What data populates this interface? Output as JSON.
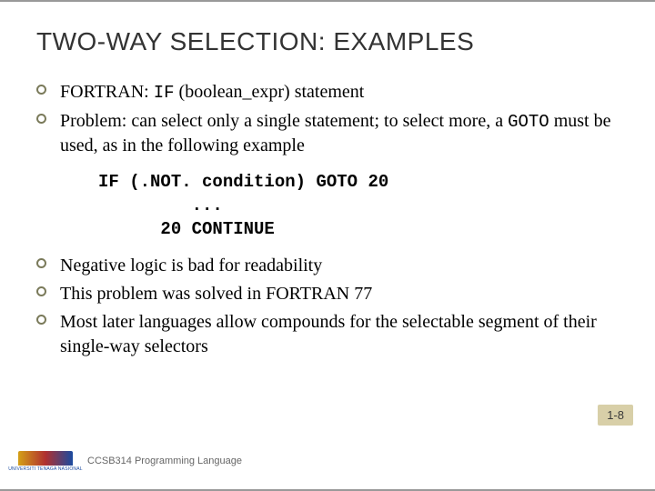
{
  "title": "TWO-WAY SELECTION: EXAMPLES",
  "bullets1": [
    {
      "pre": "FORTRAN: ",
      "code": "IF",
      "post": " (boolean_expr) statement"
    },
    {
      "pre": "Problem: can select only a single statement; to select more, a ",
      "code": "GOTO",
      "post": " must be used, as in the following example"
    }
  ],
  "code": {
    "l1": "IF (.NOT. condition) GOTO 20",
    "l2": "         ...",
    "l3": "      20 CONTINUE"
  },
  "bullets2": [
    "Negative logic is bad for readability",
    "This problem was solved in FORTRAN 77",
    "Most later languages allow compounds for the selectable segment of their single-way selectors"
  ],
  "pageNum": "1-8",
  "logoText": "UNIVERSITI TENAGA NASIONAL",
  "course": "CCSB314 Programming Language"
}
